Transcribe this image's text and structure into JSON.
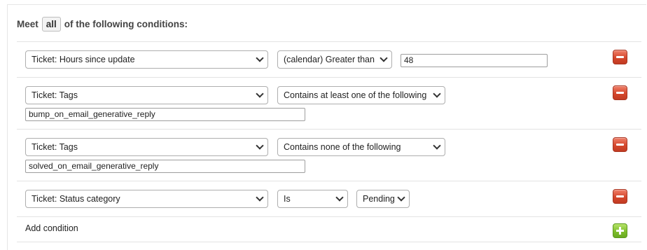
{
  "header": {
    "prefix": "Meet",
    "match": "all",
    "suffix": "of the following conditions:"
  },
  "conditions": [
    {
      "field": "Ticket: Hours since update",
      "operator": "(calendar) Greater than",
      "value": "48"
    },
    {
      "field": "Ticket: Tags",
      "operator": "Contains at least one of the following",
      "value": "bump_on_email_generative_reply"
    },
    {
      "field": "Ticket: Tags",
      "operator": "Contains none of the following",
      "value": "solved_on_email_generative_reply"
    },
    {
      "field": "Ticket: Status category",
      "operator": "Is",
      "value": "Pending"
    }
  ],
  "add_condition_label": "Add condition",
  "colors": {
    "remove": "#d4472c",
    "add": "#7fbf2c"
  },
  "icons": {
    "remove": "minus-icon",
    "add": "plus-icon",
    "dropdown": "chevron-down-icon"
  }
}
